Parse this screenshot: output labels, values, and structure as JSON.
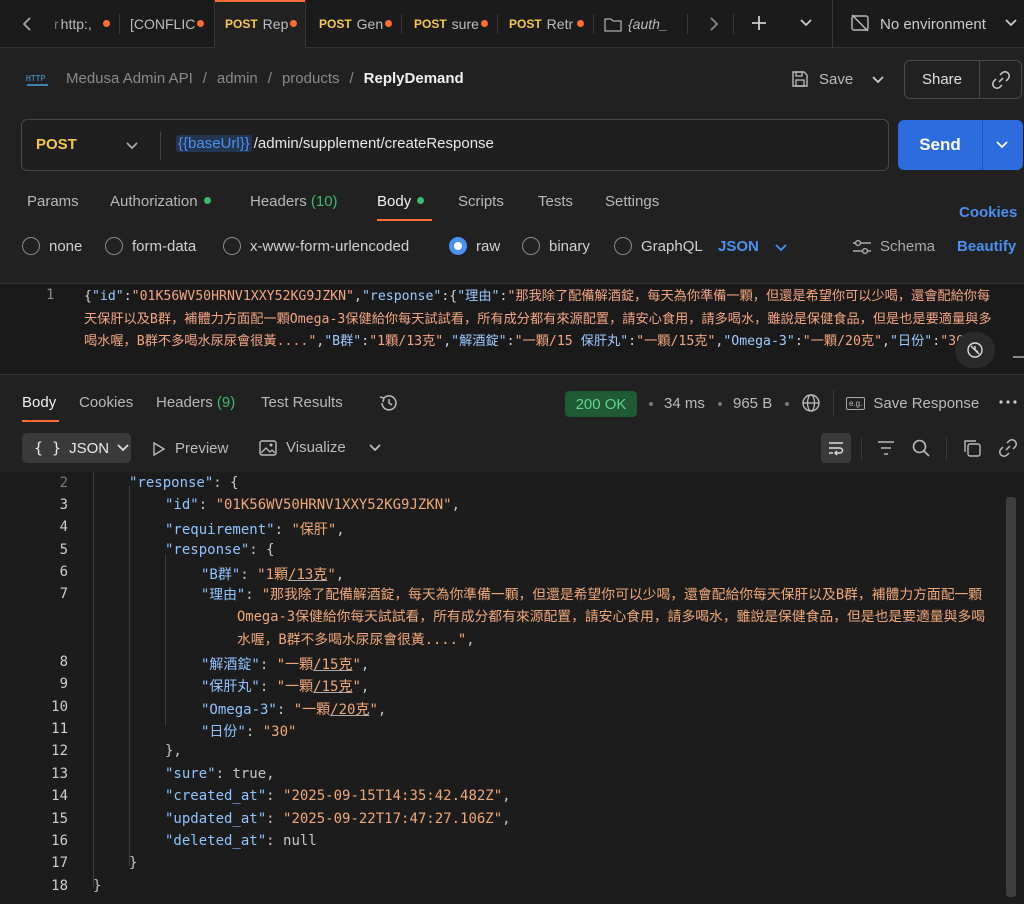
{
  "tabs": [
    {
      "method": "",
      "label": "http:,",
      "dirty": true
    },
    {
      "method": "",
      "label": "[CONFLIC",
      "dirty": true
    },
    {
      "method": "POST",
      "label": "Rep",
      "dirty": true,
      "active": true
    },
    {
      "method": "POST",
      "label": "Gen",
      "dirty": true
    },
    {
      "method": "POST",
      "label": "sure",
      "dirty": true
    },
    {
      "method": "POST",
      "label": "Retr",
      "dirty": true
    },
    {
      "method": "",
      "label": "{auth_",
      "dirty": false
    }
  ],
  "environment": "No environment",
  "breadcrumb": {
    "workspace": "Medusa Admin API",
    "folder1": "admin",
    "folder2": "products",
    "current": "ReplyDemand",
    "sep": "/"
  },
  "header": {
    "save_label": "Save",
    "share_label": "Share",
    "http_badge": "HTTP"
  },
  "request": {
    "method": "POST",
    "base_var": "{{baseUrl}}",
    "path": "/admin/supplement/createResponse",
    "send_label": "Send"
  },
  "request_tabs": {
    "params": "Params",
    "authorization": "Authorization",
    "headers": "Headers",
    "headers_count": "(10)",
    "body": "Body",
    "scripts": "Scripts",
    "tests": "Tests",
    "settings": "Settings",
    "cookies": "Cookies"
  },
  "body_types": {
    "none": "none",
    "form_data": "form-data",
    "urlencoded": "x-www-form-urlencoded",
    "raw": "raw",
    "binary": "binary",
    "graphql": "GraphQL",
    "format": "JSON",
    "schema": "Schema",
    "beautify": "Beautify"
  },
  "request_body": {
    "line_no": "1",
    "p1": "{",
    "k_id": "\"id\"",
    "c1": ":",
    "v_id": "\"01K56WV50HRNV1XXY52KG9JZKN\"",
    "c2": ",",
    "k_resp": "\"response\"",
    "c3": ":{",
    "k_reason": "\"理由\"",
    "c4": ":",
    "v_reason": "\"那我除了配備解酒錠，每天為你準備一顆，但還是希望你可以少喝，還會配給你每天保肝以及B群，補體力方面配一顆Omega-3保健給你每天試試看，所有成分都有來源配置，請安心食用，請多喝水，雖說是保健食品，但是也是要適量與多喝水喔，B群不多喝水尿尿會很黃....\"",
    "c5": ",",
    "k_b": "\"B群\"",
    "c6": ":",
    "v_b": "\"1顆/13克\"",
    "c7": ",",
    "k_jiu": "\"解酒錠\"",
    "c8": ":",
    "v_jiu": "\"一顆/15",
    "k_gan": "保肝丸\"",
    "c9": ":",
    "v_gan": "\"一顆/15克\"",
    "c10": ",",
    "k_omega": "\"Omega-3\"",
    "c11": ":",
    "v_omega": "\"一顆/20克\"",
    "c12": ",",
    "k_days": "\"日份\"",
    "c13": ":",
    "v_days": "\"30\"",
    "p2": "}}"
  },
  "response_tabs": {
    "body": "Body",
    "cookies": "Cookies",
    "headers": "Headers",
    "headers_count": "(9)",
    "test_results": "Test Results",
    "status": "200 OK",
    "time": "34 ms",
    "size": "965 B",
    "save_response": "Save Response",
    "eg_badge": "e.g."
  },
  "response_view": {
    "format": "JSON",
    "preview": "Preview",
    "visualize": "Visualize"
  },
  "response_lines": [
    {
      "n": "2",
      "key": "\"response\"",
      "punct": ": {"
    },
    {
      "n": "3",
      "key": "\"id\"",
      "punct": ": ",
      "val": "\"01K56WV50HRNV1XXY52KG9JZKN\"",
      "end": ","
    },
    {
      "n": "4",
      "key": "\"requirement\"",
      "punct": ": ",
      "val": "\"保肝\"",
      "end": ","
    },
    {
      "n": "5",
      "key": "\"response\"",
      "punct": ": {"
    },
    {
      "n": "6",
      "key": "\"B群\"",
      "punct": ": ",
      "val_a": "\"1顆",
      "val_u": "/13克",
      "val_b": "\"",
      "end": ","
    },
    {
      "n": "7",
      "key": "\"理由\"",
      "punct": ": ",
      "val": "\"那我除了配備解酒錠，每天為你準備一顆，但還是希望你可以少喝，還會配給你每天保肝以及B群，補體力方面配一顆Omega-3保健給你每天試試看，所有成分都有來源配置，請安心食用，請多喝水，雖說是保健食品，但是也是要適量與多喝水喔，B群不多喝水尿尿會很黃....\"",
      "end": ","
    },
    {
      "n": "8",
      "key": "\"解酒錠\"",
      "punct": ": ",
      "val_a": "\"一顆",
      "val_u": "/15克",
      "val_b": "\"",
      "end": ","
    },
    {
      "n": "9",
      "key": "\"保肝丸\"",
      "punct": ": ",
      "val_a": "\"一顆",
      "val_u": "/15克",
      "val_b": "\"",
      "end": ","
    },
    {
      "n": "10",
      "key": "\"Omega-3\"",
      "punct": ": ",
      "val_a": "\"一顆",
      "val_u": "/20克",
      "val_b": "\"",
      "end": ","
    },
    {
      "n": "11",
      "key": "\"日份\"",
      "punct": ": ",
      "val": "\"30\""
    },
    {
      "n": "12",
      "text": "},"
    },
    {
      "n": "13",
      "key": "\"sure\"",
      "punct": ": ",
      "lit": "true",
      "end": ","
    },
    {
      "n": "14",
      "key": "\"created_at\"",
      "punct": ": ",
      "val": "\"2025-09-15T14:35:42.482Z\"",
      "end": ","
    },
    {
      "n": "15",
      "key": "\"updated_at\"",
      "punct": ": ",
      "val": "\"2025-09-22T17:47:27.106Z\"",
      "end": ","
    },
    {
      "n": "16",
      "key": "\"deleted_at\"",
      "punct": ": ",
      "lit": "null"
    },
    {
      "n": "17",
      "text": "}"
    },
    {
      "n": "18",
      "text": "}"
    }
  ],
  "colors": {
    "accent": "#ff6c37",
    "send": "#2d6cdf",
    "ok_bg": "#1f5a34",
    "ok_text": "#62d48a",
    "link": "#4a90f0"
  }
}
